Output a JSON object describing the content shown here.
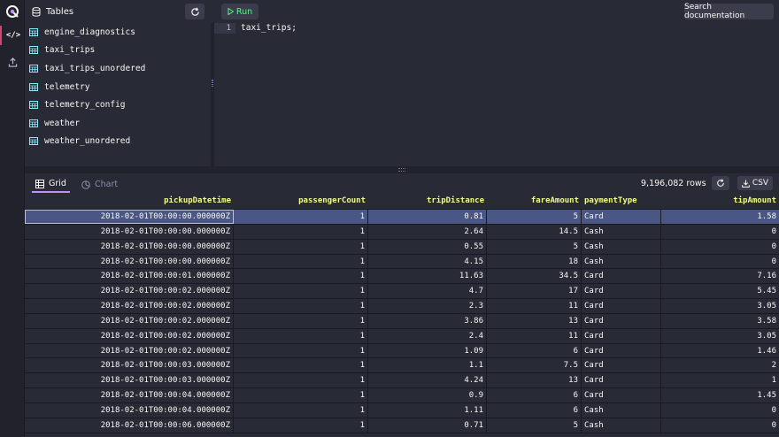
{
  "colors": {
    "accent": "#bd93f9",
    "run_green": "#50fa7b",
    "header_yellow": "#f1fa8c",
    "active_pink": "#d14671",
    "selected_row": "#4a5785"
  },
  "icons": {
    "logo": "questdb-logo-icon",
    "code": "code-icon",
    "import": "upload-icon",
    "tables": "database-icon",
    "refresh": "refresh-icon",
    "run": "play-icon",
    "grid": "grid-icon",
    "chart": "chart-icon",
    "download": "download-icon",
    "table": "table-icon"
  },
  "sidebar": {
    "code_label": "</>"
  },
  "schema": {
    "title": "Tables",
    "tables": [
      "engine_diagnostics",
      "taxi_trips",
      "taxi_trips_unordered",
      "telemetry",
      "telemetry_config",
      "weather",
      "weather_unordered"
    ]
  },
  "toolbar": {
    "run_label": "Run",
    "search_docs_label": "Search documentation"
  },
  "editor": {
    "line_number": "1",
    "code": "taxi_trips;"
  },
  "result": {
    "tabs": [
      {
        "label": "Grid"
      },
      {
        "label": "Chart"
      }
    ],
    "row_count": "9,196,082 rows",
    "csv_label": "CSV",
    "columns": [
      "pickupDatetime",
      "passengerCount",
      "tripDistance",
      "fareAmount",
      "paymentType",
      "tipAmount"
    ],
    "rows": [
      [
        "2018-02-01T00:00:00.000000Z",
        "1",
        "0.81",
        "5",
        "Card",
        "1.58"
      ],
      [
        "2018-02-01T00:00:00.000000Z",
        "1",
        "2.64",
        "14.5",
        "Cash",
        "0"
      ],
      [
        "2018-02-01T00:00:00.000000Z",
        "1",
        "0.55",
        "5",
        "Cash",
        "0"
      ],
      [
        "2018-02-01T00:00:00.000000Z",
        "1",
        "4.15",
        "18",
        "Cash",
        "0"
      ],
      [
        "2018-02-01T00:00:01.000000Z",
        "1",
        "11.63",
        "34.5",
        "Card",
        "7.16"
      ],
      [
        "2018-02-01T00:00:02.000000Z",
        "1",
        "4.7",
        "17",
        "Card",
        "5.45"
      ],
      [
        "2018-02-01T00:00:02.000000Z",
        "1",
        "2.3",
        "11",
        "Card",
        "3.05"
      ],
      [
        "2018-02-01T00:00:02.000000Z",
        "1",
        "3.86",
        "13",
        "Card",
        "3.58"
      ],
      [
        "2018-02-01T00:00:02.000000Z",
        "1",
        "2.4",
        "11",
        "Card",
        "3.05"
      ],
      [
        "2018-02-01T00:00:02.000000Z",
        "1",
        "1.09",
        "6",
        "Card",
        "1.46"
      ],
      [
        "2018-02-01T00:00:03.000000Z",
        "1",
        "1.1",
        "7.5",
        "Card",
        "2"
      ],
      [
        "2018-02-01T00:00:03.000000Z",
        "1",
        "4.24",
        "13",
        "Card",
        "1"
      ],
      [
        "2018-02-01T00:00:04.000000Z",
        "1",
        "0.9",
        "6",
        "Card",
        "1.45"
      ],
      [
        "2018-02-01T00:00:04.000000Z",
        "1",
        "1.11",
        "6",
        "Cash",
        "0"
      ],
      [
        "2018-02-01T00:00:06.000000Z",
        "1",
        "0.71",
        "5",
        "Cash",
        "0"
      ]
    ]
  }
}
